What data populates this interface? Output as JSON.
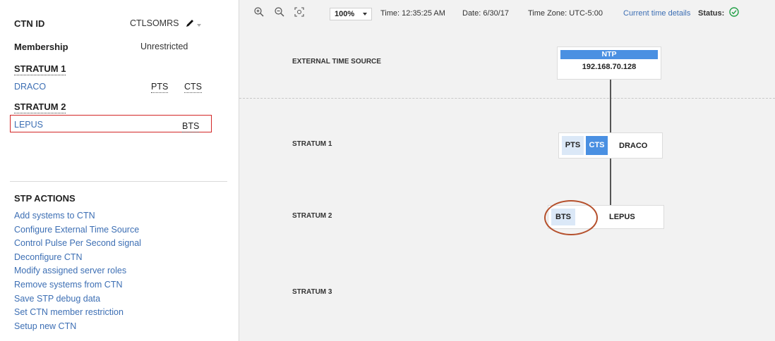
{
  "left_panel": {
    "ctn_id_label": "CTN ID",
    "ctn_id_value": "CTLSOMRS",
    "membership_label": "Membership",
    "membership_value": "Unrestricted",
    "stratum1_label": "STRATUM 1",
    "stratum1_systems": [
      {
        "name": "DRACO",
        "roles": [
          "PTS",
          "CTS"
        ]
      }
    ],
    "stratum2_label": "STRATUM 2",
    "stratum2_systems": [
      {
        "name": "LEPUS",
        "roles": [
          "BTS"
        ]
      }
    ],
    "actions_title": "STP ACTIONS",
    "actions": [
      "Add systems to CTN",
      "Configure External Time Source",
      "Control Pulse Per Second signal",
      "Deconfigure CTN",
      "Modify assigned server roles",
      "Remove systems from CTN",
      "Save STP debug data",
      "Set CTN member restriction",
      "Setup new CTN"
    ]
  },
  "toolbar": {
    "zoom": "100%",
    "time": "Time: 12:35:25 AM",
    "date": "Date: 6/30/17",
    "timezone": "Time Zone: UTC-5:00",
    "details_link": "Current time details",
    "status_label": "Status:",
    "status_color": "#24a148",
    "icons": [
      "zoom-in-icon",
      "zoom-out-icon",
      "fit-to-screen-icon",
      "status-ok-icon"
    ]
  },
  "topology": {
    "levels": {
      "external": "EXTERNAL TIME SOURCE",
      "stratum1": "STRATUM 1",
      "stratum2": "STRATUM 2",
      "stratum3": "STRATUM 3"
    },
    "ntp": {
      "header": "NTP",
      "address": "192.168.70.128"
    },
    "draco": {
      "roles": [
        "PTS",
        "CTS"
      ],
      "name": "DRACO"
    },
    "lepus": {
      "roles": [
        "BTS"
      ],
      "name": "LEPUS"
    }
  },
  "colors": {
    "link": "#3d6fb4",
    "accent_blue": "#4a90e2",
    "role_light": "#dbe8f7",
    "selection_border": "#d32626",
    "highlight_circle": "#b5502c"
  }
}
